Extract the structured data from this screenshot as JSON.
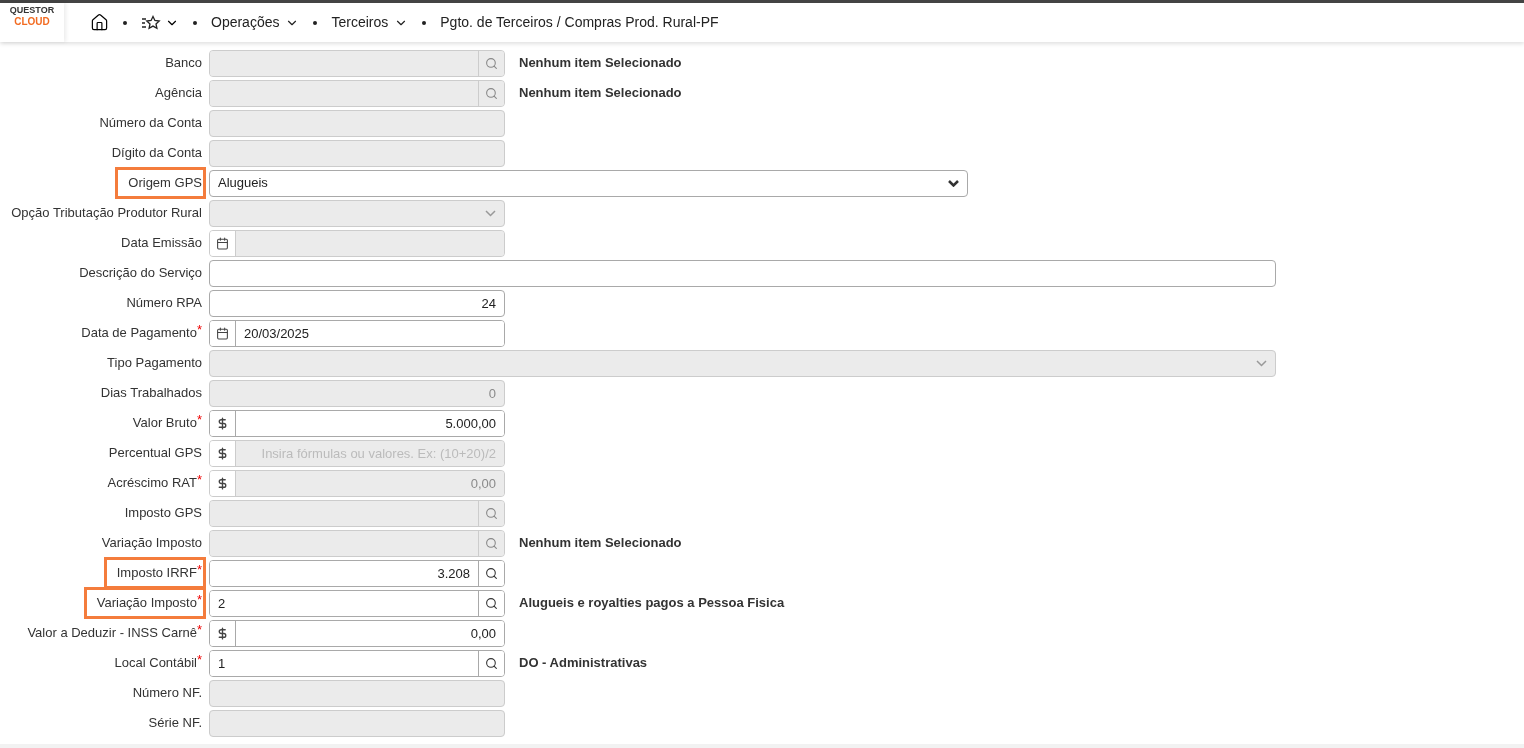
{
  "logo": {
    "line_1": "QUESTOR",
    "line_2": "CLOUD"
  },
  "breadcrumb": {
    "items": [
      {
        "kind": "home"
      },
      {
        "kind": "favorites",
        "dropdown": true
      },
      {
        "kind": "text",
        "label": "Operações",
        "dropdown": true
      },
      {
        "kind": "text",
        "label": "Terceiros",
        "dropdown": true
      },
      {
        "kind": "text",
        "label": "Pgto. de Terceiros / Compras Prod. Rural-PF",
        "dropdown": false
      }
    ]
  },
  "fields": [
    {
      "label": "Banco",
      "kind": "lookup",
      "wide": false,
      "full_width": false,
      "disabled": true,
      "highlighted": false,
      "description": "Nenhum item Selecionado"
    },
    {
      "label": "Agência",
      "kind": "lookup",
      "wide": false,
      "full_width": false,
      "disabled": true,
      "highlighted": false,
      "description": "Nenhum item Selecionado"
    },
    {
      "label": "Número da Conta",
      "kind": "text",
      "wide": false,
      "full_width": false,
      "disabled": true,
      "highlighted": false
    },
    {
      "label": "Dígito da Conta",
      "kind": "text",
      "wide": false,
      "full_width": false,
      "disabled": true,
      "highlighted": false
    },
    {
      "label": "Origem GPS",
      "kind": "select",
      "wide": true,
      "full_width": false,
      "disabled": false,
      "highlighted": true,
      "value": "Alugueis"
    },
    {
      "label": "Opção Tributação Produtor Rural",
      "kind": "select",
      "wide": false,
      "full_width": false,
      "disabled": true,
      "highlighted": false
    },
    {
      "label": "Data Emissão",
      "kind": "date",
      "wide": false,
      "full_width": false,
      "disabled": true,
      "highlighted": false
    },
    {
      "label": "Descrição do Serviço",
      "kind": "text",
      "wide": true,
      "full_width": true,
      "disabled": false,
      "highlighted": false
    },
    {
      "label": "Número RPA",
      "kind": "text",
      "wide": false,
      "full_width": false,
      "disabled": false,
      "highlighted": false,
      "value": "24",
      "numeric": true
    },
    {
      "label": "Data de Pagamento",
      "required_mark": "*",
      "kind": "date",
      "wide": false,
      "full_width": false,
      "disabled": false,
      "highlighted": false,
      "value": "20/03/2025",
      "numeric": false
    },
    {
      "label": "Tipo Pagamento",
      "kind": "select",
      "wide": true,
      "full_width": true,
      "disabled": true,
      "highlighted": false
    },
    {
      "label": "Dias Trabalhados",
      "kind": "text",
      "wide": false,
      "full_width": false,
      "disabled": true,
      "highlighted": false,
      "value": "0",
      "numeric": true
    },
    {
      "label": "Valor Bruto",
      "required_mark": "*",
      "kind": "money",
      "wide": false,
      "full_width": false,
      "disabled": false,
      "highlighted": false,
      "value": "5.000,00",
      "numeric": true
    },
    {
      "label": "Percentual GPS",
      "kind": "money",
      "wide": false,
      "full_width": false,
      "disabled": true,
      "highlighted": false,
      "placeholder": "Insira fórmulas ou valores. Ex: (10+20)/2",
      "numeric": true
    },
    {
      "label": "Acréscimo RAT",
      "required_mark": "*",
      "kind": "money",
      "wide": false,
      "full_width": false,
      "disabled": true,
      "highlighted": false,
      "value": "0,00",
      "numeric": true
    },
    {
      "label": "Imposto GPS",
      "kind": "lookup",
      "wide": false,
      "full_width": false,
      "disabled": true,
      "highlighted": false
    },
    {
      "label": "Variação Imposto",
      "kind": "lookup",
      "wide": false,
      "full_width": false,
      "disabled": true,
      "highlighted": false,
      "description": "Nenhum item Selecionado"
    },
    {
      "label": "Imposto IRRF",
      "required_mark": "*",
      "kind": "lookup",
      "wide": false,
      "full_width": false,
      "disabled": false,
      "highlighted": true,
      "value": "3.208",
      "numeric": true
    },
    {
      "label": "Variação Imposto",
      "required_mark": "*",
      "kind": "lookup",
      "wide": false,
      "full_width": false,
      "disabled": false,
      "highlighted": true,
      "value": "2",
      "numeric": false,
      "description": "Alugueis e royalties pagos a Pessoa Fisica"
    },
    {
      "label": "Valor a Deduzir - INSS Carnê",
      "required_mark": "*",
      "kind": "money",
      "wide": false,
      "full_width": false,
      "disabled": false,
      "highlighted": false,
      "value": "0,00",
      "numeric": true
    },
    {
      "label": "Local Contábil",
      "required_mark": "*",
      "kind": "lookup",
      "wide": false,
      "full_width": false,
      "disabled": false,
      "highlighted": false,
      "value": "1",
      "numeric": false,
      "description": "DO - Administrativas"
    },
    {
      "label": "Número NF.",
      "kind": "text",
      "wide": false,
      "full_width": false,
      "disabled": true,
      "highlighted": false
    },
    {
      "label": "Série NF.",
      "kind": "text",
      "wide": false,
      "full_width": false,
      "disabled": true,
      "highlighted": false
    }
  ]
}
